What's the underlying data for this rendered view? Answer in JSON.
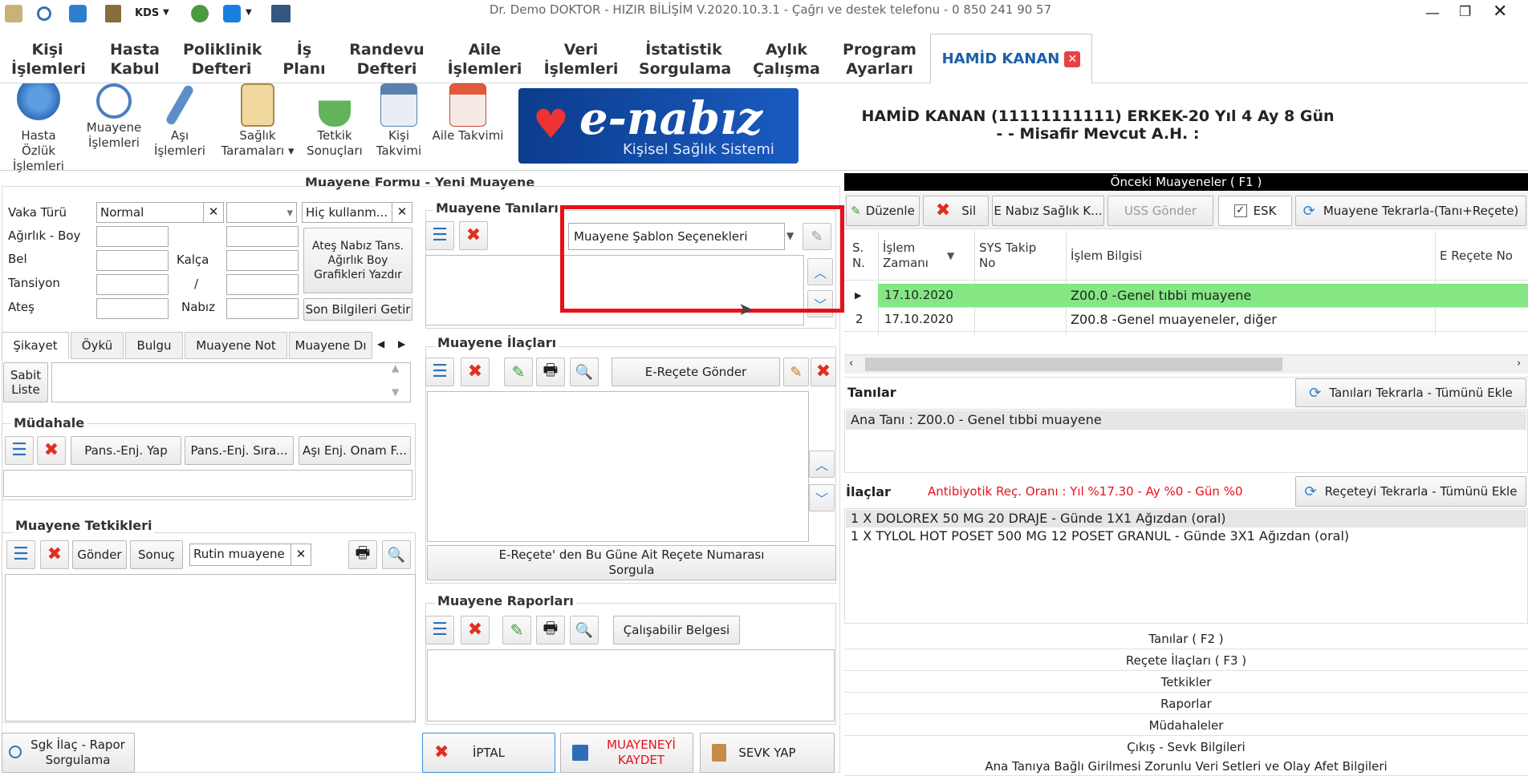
{
  "window": {
    "title": "Dr. Demo DOKTOR - HIZIR BİLİŞİM V.2020.10.3.1 - Çağrı ve destek telefonu - 0 850 241 90 57"
  },
  "quickbar": {
    "kds_label": "KDS"
  },
  "menu": {
    "items": [
      "Kişi İşlemleri",
      "Hasta Kabul",
      "Poliklinik Defteri",
      "İş Planı",
      "Randevu Defteri",
      "Aile İşlemleri",
      "Veri İşlemleri",
      "İstatistik Sorgulama",
      "Aylık Çalışma",
      "Program Ayarları"
    ],
    "active_patient_tab": "HAMİD KANAN"
  },
  "toolbar": {
    "items": [
      "Hasta Özlük İşlemleri",
      "Muayene İşlemleri",
      "Aşı İşlemleri",
      "Sağlık Taramaları",
      "Tetkik Sonuçları",
      "Kişi Takvimi",
      "Aile Takvimi"
    ],
    "enabiz_title": "e-nabız",
    "enabiz_sub": "Kişisel Sağlık Sistemi"
  },
  "patient": {
    "line1": "HAMİD KANAN (11111111111)  ERKEK-20 Yıl 4 Ay 8 Gün",
    "line2": "-  - Misafir Mevcut A.H. :"
  },
  "form": {
    "title": "Muayene Formu - Yeni Muayene",
    "vaka_turu_label": "Vaka Türü",
    "vaka_turu_value": "Normal",
    "hic_kullanm": "Hiç kullanm...",
    "agirlik_boy": "Ağırlık - Boy",
    "bel": "Bel",
    "kalca": "Kalça",
    "tansiyon": "Tansiyon",
    "slash": "/",
    "ates": "Ateş",
    "nabiz": "Nabız",
    "grafik_btn": "Ateş Nabız Tans. Ağırlık Boy Grafikleri Yazdır",
    "son_bilgiler": "Son Bilgileri Getir",
    "tabs": [
      "Şikayet",
      "Öykü",
      "Bulgu",
      "Muayene Not",
      "Muayene Dı"
    ],
    "sabit_liste": "Sabit Liste",
    "mudahale_title": "Müdahale",
    "pans_enj_yap": "Pans.-Enj. Yap",
    "pans_enj_sira": "Pans.-Enj. Sıra...",
    "asi_enj_onam": "Aşı Enj. Onam F...",
    "tetkik_title": "Muayene Tetkikleri",
    "gonder": "Gönder",
    "sonuc": "Sonuç",
    "rutin": "Rutin muayene",
    "sgk_btn": "Sgk İlaç - Rapor Sorgulama"
  },
  "tanilar_panel": {
    "title": "Muayene Tanıları",
    "sablon_placeholder": "Muayene Şablon Seçenekleri"
  },
  "ilaclar_panel": {
    "title": "Muayene İlaçları",
    "erecete_gonder": "E-Reçete Gönder",
    "erecete_sorgula": "E-Reçete' den Bu Güne Ait Reçete Numarası Sorgula"
  },
  "raporlar_panel": {
    "title": "Muayene Raporları",
    "calisabilir": "Çalışabilir Belgesi"
  },
  "bottom_buttons": {
    "iptal": "İPTAL",
    "kaydet": "MUAYENEYİ KAYDET",
    "sevk": "SEVK YAP"
  },
  "onceki": {
    "title": "Önceki Muayeneler ( F1 )",
    "duzenle": "Düzenle",
    "sil": "Sil",
    "enabiz": "E Nabız Sağlık K...",
    "uss": "USS Gönder",
    "esk": "ESK",
    "tekrarla": "Muayene Tekrarla-(Tanı+Reçete)",
    "columns": [
      "S. N.",
      "İşlem Zamanı",
      "SYS Takip No",
      "İşlem Bilgisi",
      "E Reçete No"
    ],
    "rows": [
      {
        "sn": "",
        "date": "17.10.2020",
        "sys": "",
        "info": "Z00.0 -Genel tıbbi muayene",
        "erecete": ""
      },
      {
        "sn": "2",
        "date": "17.10.2020",
        "sys": "",
        "info": "Z00.8 -Genel muayeneler, diğer",
        "erecete": ""
      }
    ]
  },
  "tanilar_right": {
    "title": "Tanılar",
    "tekrarla": "Tanıları Tekrarla - Tümünü Ekle",
    "items": [
      "Ana Tanı : Z00.0 - Genel tıbbi muayene"
    ]
  },
  "ilaclar_right": {
    "title": "İlaçlar",
    "antibiyotik": "Antibiyotik Reç. Oranı : Yıl %17.30  - Ay %0  - Gün %0",
    "tekrarla": "Reçeteyi Tekrarla - Tümünü Ekle",
    "items": [
      "1 X DOLOREX 50 MG 20 DRAJE - Günde 1X1 Ağızdan (oral)",
      "1 X TYLOL HOT POSET 500 MG 12 POSET GRANUL - Günde 3X1 Ağızdan (oral)"
    ]
  },
  "accordion": [
    "Tanılar ( F2 )",
    "Reçete İlaçları ( F3 )",
    "Tetkikler",
    "Raporlar",
    "Müdahaleler",
    "Çıkış - Sevk Bilgileri",
    "Ana Tanıya Bağlı Girilmesi Zorunlu Veri Setleri ve Olay Afet Bilgileri"
  ],
  "colors": {
    "highlight_red": "#e8101a",
    "row_selected": "#84e784",
    "accent_blue": "#1c5fa8"
  }
}
